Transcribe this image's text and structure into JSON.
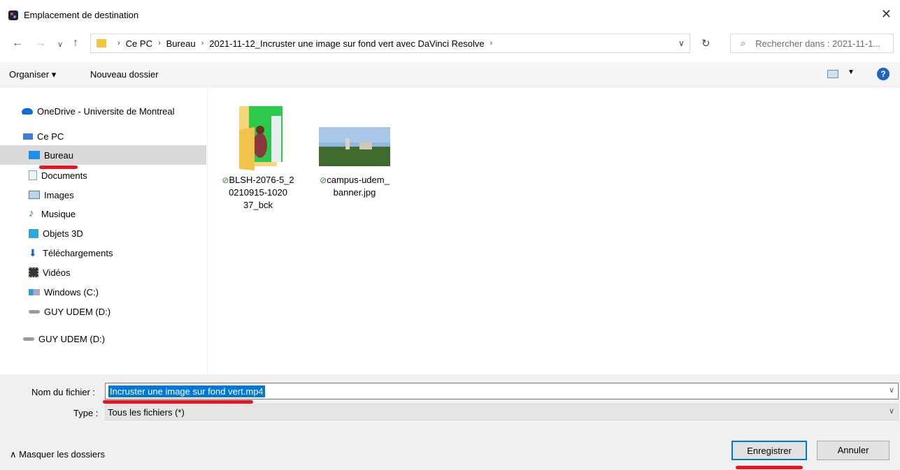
{
  "window": {
    "title": "Emplacement de destination"
  },
  "nav": {
    "back": "←",
    "forward": "→",
    "recent": "∨",
    "up": "↑",
    "breadcrumb": [
      "Ce PC",
      "Bureau",
      "2021-11-12_Incruster une image sur fond vert avec DaVinci Resolve"
    ],
    "search_placeholder": "Rechercher dans : 2021-11-1..."
  },
  "toolbar": {
    "organize": "Organiser ▾",
    "new_folder": "Nouveau dossier",
    "help": "?"
  },
  "sidebar": {
    "items": [
      {
        "label": "OneDrive - Universite de Montreal",
        "icon": "cloud-icon"
      },
      {
        "label": "Ce PC",
        "icon": "computer-icon"
      },
      {
        "label": "Bureau",
        "icon": "desktop-icon",
        "selected": true
      },
      {
        "label": "Documents",
        "icon": "documents-icon"
      },
      {
        "label": "Images",
        "icon": "images-icon"
      },
      {
        "label": "Musique",
        "icon": "music-icon"
      },
      {
        "label": "Objets 3D",
        "icon": "3d-objects-icon"
      },
      {
        "label": "Téléchargements",
        "icon": "downloads-icon"
      },
      {
        "label": "Vidéos",
        "icon": "videos-icon"
      },
      {
        "label": "Windows (C:)",
        "icon": "drive-c-icon"
      },
      {
        "label": "GUY UDEM (D:)",
        "icon": "usb-drive-icon"
      },
      {
        "label": "GUY UDEM (D:)",
        "icon": "usb-drive-icon"
      }
    ]
  },
  "files": [
    {
      "name_lines": [
        "BLSH-2076-5_2",
        "0210915-1020",
        "37_bck"
      ],
      "type": "folder"
    },
    {
      "name_lines": [
        "campus-udem_",
        "banner.jpg"
      ],
      "type": "image"
    }
  ],
  "form": {
    "filename_label": "Nom du fichier :",
    "filename_value": "Incruster une image sur fond vert.mp4",
    "type_label": "Type :",
    "type_value": "Tous les fichiers (*)"
  },
  "footer": {
    "hide_folders": "Masquer les dossiers",
    "save": "Enregistrer",
    "cancel": "Annuler"
  },
  "colors": {
    "accent": "#0078d7",
    "annotation": "#e8141e"
  }
}
